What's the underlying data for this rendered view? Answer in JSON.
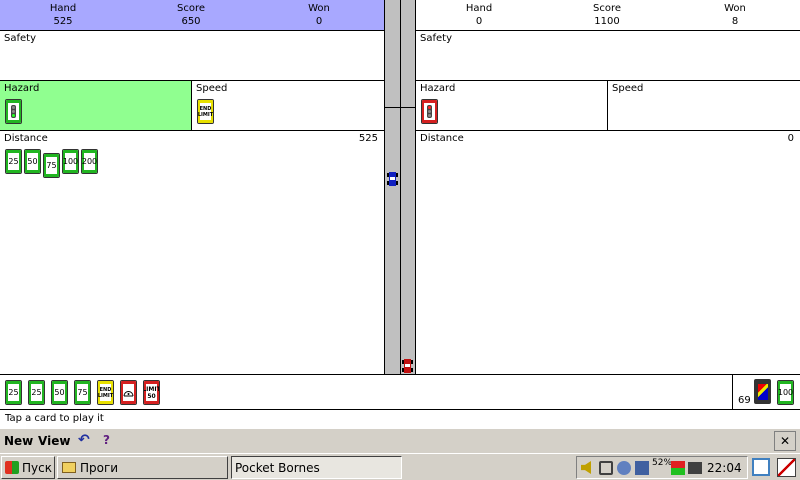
{
  "player": {
    "header": [
      {
        "label": "Hand",
        "value": "525"
      },
      {
        "label": "Score",
        "value": "650"
      },
      {
        "label": "Won",
        "value": "0"
      }
    ],
    "safety_label": "Safety",
    "hazard_label": "Hazard",
    "speed_label": "Speed",
    "distance_label": "Distance",
    "distance_value": "525",
    "speed_card": "END LIMIT",
    "distance_cards": [
      "25",
      "50",
      "75",
      "100",
      "200"
    ]
  },
  "opponent": {
    "header": [
      {
        "label": "Hand",
        "value": "0"
      },
      {
        "label": "Score",
        "value": "1100"
      },
      {
        "label": "Won",
        "value": "8"
      }
    ],
    "safety_label": "Safety",
    "hazard_label": "Hazard",
    "speed_label": "Speed",
    "distance_label": "Distance",
    "distance_value": "0"
  },
  "hand": {
    "cards": [
      {
        "text": "25",
        "color": "green"
      },
      {
        "text": "25",
        "color": "green"
      },
      {
        "text": "50",
        "color": "green"
      },
      {
        "text": "75",
        "color": "green"
      },
      {
        "text": "END LIMIT",
        "color": "yellow"
      },
      {
        "text": "",
        "color": "red",
        "icon": "flat-tire"
      },
      {
        "text": "LIMIT 50",
        "color": "red"
      }
    ],
    "deck_count": "69",
    "discard_card": "100"
  },
  "status": "Tap a card to play it",
  "menu": {
    "new": "New",
    "view": "View",
    "undo": "↶",
    "help": "?",
    "close": "✕"
  },
  "taskbar": {
    "start": "Пуск",
    "folder": "Проги",
    "app": "Pocket Bornes",
    "battery": "52%",
    "time": "22:04"
  },
  "colors": {
    "active_header": "#a8a8ff",
    "active_hazard": "#90ff90",
    "road": "#c0c0c0",
    "menubar": "#d4d0c8"
  }
}
